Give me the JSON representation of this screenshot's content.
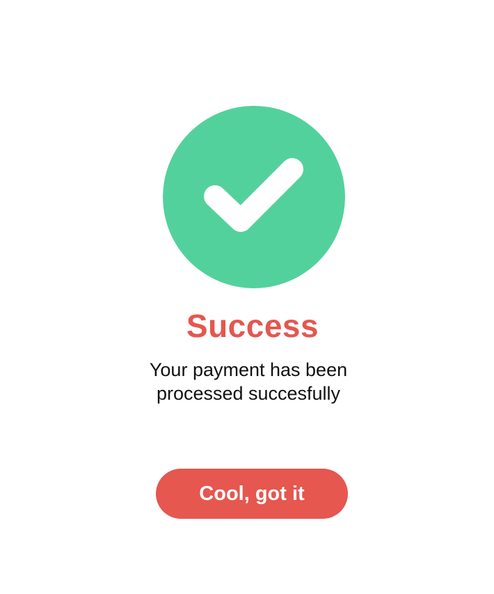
{
  "dialog": {
    "icon": "check-circle-icon",
    "title": "Success",
    "message_lines": [
      "Your payment has been",
      "processed succesfully"
    ],
    "button_label": "Cool, got it"
  },
  "colors": {
    "success_green": "#53d19d",
    "accent_red": "#e5574f",
    "background": "#ffffff",
    "text": "#111111"
  }
}
